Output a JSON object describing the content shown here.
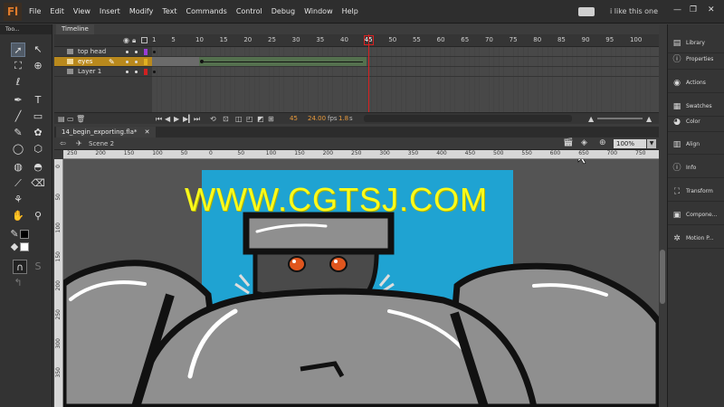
{
  "app": {
    "logo": "Fl",
    "workspace": "i like this one"
  },
  "menus": [
    "File",
    "Edit",
    "View",
    "Insert",
    "Modify",
    "Text",
    "Commands",
    "Control",
    "Debug",
    "Window",
    "Help"
  ],
  "window_controls": {
    "minimize": "—",
    "restore": "❐",
    "close": "✕"
  },
  "tools": {
    "title": "Too..."
  },
  "timeline": {
    "tab": "Timeline",
    "frame_numbers": [
      "1",
      "5",
      "10",
      "15",
      "20",
      "25",
      "30",
      "35",
      "40",
      "45",
      "50",
      "55",
      "60",
      "65",
      "70",
      "75",
      "80",
      "85",
      "90",
      "95",
      "100"
    ],
    "current_frame": 45,
    "layers": [
      {
        "name": "top head",
        "color": "#9a3cd6",
        "selected": false
      },
      {
        "name": "eyes",
        "color": "#e0b020",
        "selected": true
      },
      {
        "name": "Layer 1",
        "color": "#d02020",
        "selected": false
      }
    ],
    "footer": {
      "frame": "45",
      "fps_value": "24.00",
      "fps_unit": "fps",
      "time": "1.8",
      "time_unit": "s"
    }
  },
  "document": {
    "tab": "14_begin_exporting.fla*",
    "scene": "Scene 2",
    "zoom": "100%"
  },
  "ruler": {
    "h_labels": [
      "250",
      "200",
      "150",
      "100",
      "50",
      "0",
      "50",
      "100",
      "150",
      "200",
      "250",
      "300",
      "350",
      "400",
      "450",
      "500",
      "550",
      "600",
      "650",
      "700",
      "750"
    ],
    "v_labels": [
      "0",
      "50",
      "100",
      "150",
      "200",
      "250",
      "300",
      "350"
    ]
  },
  "watermark": "WWW.CGTSJ.COM",
  "panels": [
    {
      "label": "Library",
      "icon": "▤"
    },
    {
      "label": "Properties",
      "icon": "ⓘ"
    },
    {
      "label": "Actions",
      "icon": "◉"
    },
    {
      "label": "Swatches",
      "icon": "▦"
    },
    {
      "label": "Color",
      "icon": "◕"
    },
    {
      "label": "Align",
      "icon": "▥"
    },
    {
      "label": "Info",
      "icon": "ⓘ"
    },
    {
      "label": "Transform",
      "icon": "⛶"
    },
    {
      "label": "Compone...",
      "icon": "▣"
    },
    {
      "label": "Motion P...",
      "icon": "✲"
    }
  ],
  "colors": {
    "stage_bg": "#1fa3d2",
    "robot_gray": "#8f8f8f",
    "robot_dark": "#4a4a4a",
    "eye_orange": "#e0561e",
    "playhead": "#d82020"
  }
}
